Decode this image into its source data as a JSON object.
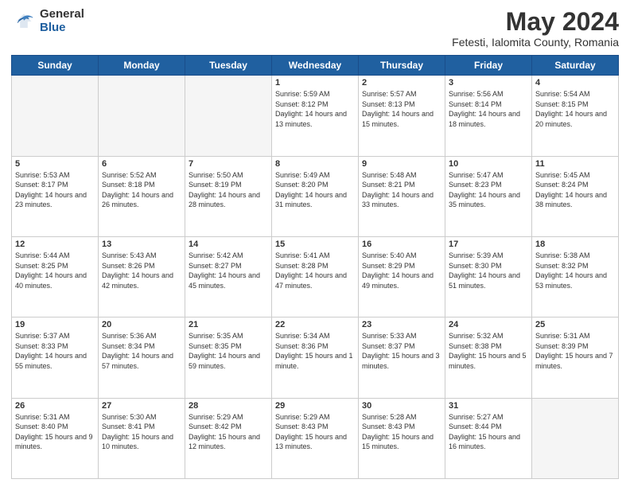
{
  "logo": {
    "general": "General",
    "blue": "Blue"
  },
  "header": {
    "month": "May 2024",
    "location": "Fetesti, Ialomita County, Romania"
  },
  "days_of_week": [
    "Sunday",
    "Monday",
    "Tuesday",
    "Wednesday",
    "Thursday",
    "Friday",
    "Saturday"
  ],
  "weeks": [
    [
      {
        "day": "",
        "empty": true
      },
      {
        "day": "",
        "empty": true
      },
      {
        "day": "",
        "empty": true
      },
      {
        "day": "1",
        "sunrise": "5:59 AM",
        "sunset": "8:12 PM",
        "daylight": "14 hours and 13 minutes."
      },
      {
        "day": "2",
        "sunrise": "5:57 AM",
        "sunset": "8:13 PM",
        "daylight": "14 hours and 15 minutes."
      },
      {
        "day": "3",
        "sunrise": "5:56 AM",
        "sunset": "8:14 PM",
        "daylight": "14 hours and 18 minutes."
      },
      {
        "day": "4",
        "sunrise": "5:54 AM",
        "sunset": "8:15 PM",
        "daylight": "14 hours and 20 minutes."
      }
    ],
    [
      {
        "day": "5",
        "sunrise": "5:53 AM",
        "sunset": "8:17 PM",
        "daylight": "14 hours and 23 minutes."
      },
      {
        "day": "6",
        "sunrise": "5:52 AM",
        "sunset": "8:18 PM",
        "daylight": "14 hours and 26 minutes."
      },
      {
        "day": "7",
        "sunrise": "5:50 AM",
        "sunset": "8:19 PM",
        "daylight": "14 hours and 28 minutes."
      },
      {
        "day": "8",
        "sunrise": "5:49 AM",
        "sunset": "8:20 PM",
        "daylight": "14 hours and 31 minutes."
      },
      {
        "day": "9",
        "sunrise": "5:48 AM",
        "sunset": "8:21 PM",
        "daylight": "14 hours and 33 minutes."
      },
      {
        "day": "10",
        "sunrise": "5:47 AM",
        "sunset": "8:23 PM",
        "daylight": "14 hours and 35 minutes."
      },
      {
        "day": "11",
        "sunrise": "5:45 AM",
        "sunset": "8:24 PM",
        "daylight": "14 hours and 38 minutes."
      }
    ],
    [
      {
        "day": "12",
        "sunrise": "5:44 AM",
        "sunset": "8:25 PM",
        "daylight": "14 hours and 40 minutes."
      },
      {
        "day": "13",
        "sunrise": "5:43 AM",
        "sunset": "8:26 PM",
        "daylight": "14 hours and 42 minutes."
      },
      {
        "day": "14",
        "sunrise": "5:42 AM",
        "sunset": "8:27 PM",
        "daylight": "14 hours and 45 minutes."
      },
      {
        "day": "15",
        "sunrise": "5:41 AM",
        "sunset": "8:28 PM",
        "daylight": "14 hours and 47 minutes."
      },
      {
        "day": "16",
        "sunrise": "5:40 AM",
        "sunset": "8:29 PM",
        "daylight": "14 hours and 49 minutes."
      },
      {
        "day": "17",
        "sunrise": "5:39 AM",
        "sunset": "8:30 PM",
        "daylight": "14 hours and 51 minutes."
      },
      {
        "day": "18",
        "sunrise": "5:38 AM",
        "sunset": "8:32 PM",
        "daylight": "14 hours and 53 minutes."
      }
    ],
    [
      {
        "day": "19",
        "sunrise": "5:37 AM",
        "sunset": "8:33 PM",
        "daylight": "14 hours and 55 minutes."
      },
      {
        "day": "20",
        "sunrise": "5:36 AM",
        "sunset": "8:34 PM",
        "daylight": "14 hours and 57 minutes."
      },
      {
        "day": "21",
        "sunrise": "5:35 AM",
        "sunset": "8:35 PM",
        "daylight": "14 hours and 59 minutes."
      },
      {
        "day": "22",
        "sunrise": "5:34 AM",
        "sunset": "8:36 PM",
        "daylight": "15 hours and 1 minute."
      },
      {
        "day": "23",
        "sunrise": "5:33 AM",
        "sunset": "8:37 PM",
        "daylight": "15 hours and 3 minutes."
      },
      {
        "day": "24",
        "sunrise": "5:32 AM",
        "sunset": "8:38 PM",
        "daylight": "15 hours and 5 minutes."
      },
      {
        "day": "25",
        "sunrise": "5:31 AM",
        "sunset": "8:39 PM",
        "daylight": "15 hours and 7 minutes."
      }
    ],
    [
      {
        "day": "26",
        "sunrise": "5:31 AM",
        "sunset": "8:40 PM",
        "daylight": "15 hours and 9 minutes."
      },
      {
        "day": "27",
        "sunrise": "5:30 AM",
        "sunset": "8:41 PM",
        "daylight": "15 hours and 10 minutes."
      },
      {
        "day": "28",
        "sunrise": "5:29 AM",
        "sunset": "8:42 PM",
        "daylight": "15 hours and 12 minutes."
      },
      {
        "day": "29",
        "sunrise": "5:29 AM",
        "sunset": "8:43 PM",
        "daylight": "15 hours and 13 minutes."
      },
      {
        "day": "30",
        "sunrise": "5:28 AM",
        "sunset": "8:43 PM",
        "daylight": "15 hours and 15 minutes."
      },
      {
        "day": "31",
        "sunrise": "5:27 AM",
        "sunset": "8:44 PM",
        "daylight": "15 hours and 16 minutes."
      },
      {
        "day": "",
        "empty": true
      }
    ]
  ]
}
